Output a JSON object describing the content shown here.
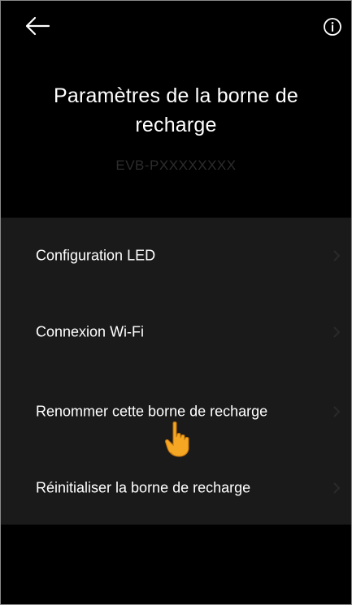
{
  "header": {
    "back_icon": "arrow-left-icon",
    "info_icon": "info-circle-icon",
    "title": "Paramètres de la borne de recharge",
    "device_id": "EVB-PXXXXXXXX"
  },
  "menu": {
    "items": [
      {
        "label": "Configuration LED"
      },
      {
        "label": "Connexion Wi-Fi"
      },
      {
        "label": "Renommer cette borne de recharge"
      },
      {
        "label": "Réinitialiser la borne de recharge"
      }
    ],
    "chevron_icon": "chevron-right-icon"
  },
  "overlay": {
    "pointer_icon": "pointing-hand-icon"
  },
  "colors": {
    "background": "#000000",
    "menu_background": "#1a1a1a",
    "text": "#ffffff",
    "subtitle": "#2c2c2c",
    "chevron": "#2a2a2a",
    "hand": "#f5a623"
  }
}
